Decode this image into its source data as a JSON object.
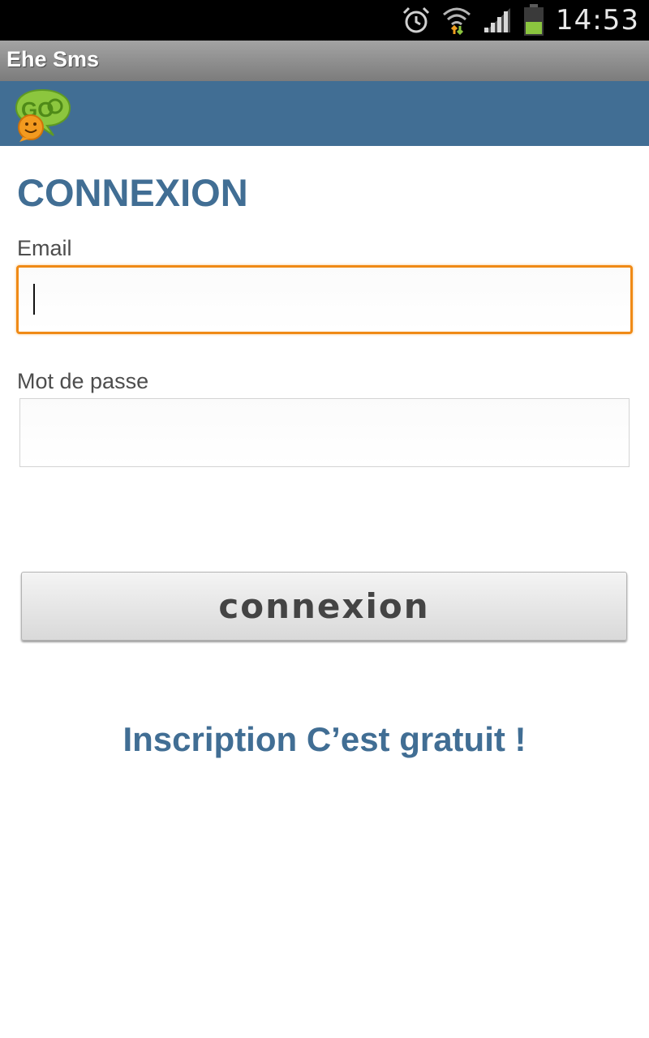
{
  "status_bar": {
    "time": "14:53",
    "icons": [
      "alarm-icon",
      "wifi-icon",
      "signal-icon",
      "battery-icon"
    ]
  },
  "app": {
    "title": "Ehe Sms",
    "header_color": "#416e94",
    "accent_color": "#f08a16"
  },
  "login": {
    "heading": "CONNEXION",
    "email_label": "Email",
    "email_value": "",
    "password_label": "Mot de passe",
    "password_value": "",
    "submit_label": "connexion",
    "signup_link": "Inscription C’est gratuit !"
  }
}
